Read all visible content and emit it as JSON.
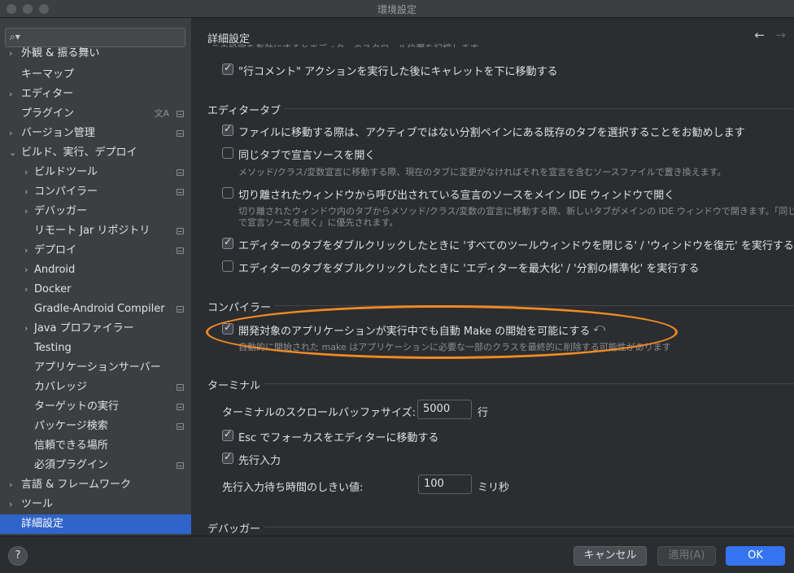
{
  "window": {
    "title": "環境設定"
  },
  "sidebar": {
    "search_placeholder": "",
    "items": [
      {
        "label": "外観 & 振る舞い"
      },
      {
        "label": "キーマップ"
      },
      {
        "label": "エディター"
      },
      {
        "label": "プラグイン"
      },
      {
        "label": "バージョン管理"
      },
      {
        "label": "ビルド、実行、デプロイ"
      },
      {
        "label": "ビルドツール"
      },
      {
        "label": "コンパイラー"
      },
      {
        "label": "デバッガー"
      },
      {
        "label": "リモート Jar リポジトリ"
      },
      {
        "label": "デプロイ"
      },
      {
        "label": "Android"
      },
      {
        "label": "Docker"
      },
      {
        "label": "Gradle-Android Compiler"
      },
      {
        "label": "Java プロファイラー"
      },
      {
        "label": "Testing"
      },
      {
        "label": "アプリケーションサーバー"
      },
      {
        "label": "カバレッジ"
      },
      {
        "label": "ターゲットの実行"
      },
      {
        "label": "パッケージ検索"
      },
      {
        "label": "信頼できる場所"
      },
      {
        "label": "必須プラグイン"
      },
      {
        "label": "言語 & フレームワーク"
      },
      {
        "label": "ツール"
      },
      {
        "label": "詳細設定"
      }
    ]
  },
  "content": {
    "title": "詳細設定",
    "top_partial_text": "この設定を有効にするとエディターのスクロール位置を記憶します",
    "line_comment": "\"行コメント\" アクションを実行した後にキャレットを下に移動する",
    "editor_tabs": {
      "header": "エディタータブ",
      "opt1": "ファイルに移動する際は、アクティブではない分割ペインにある既存のタブを選択することをお勧めします",
      "opt2": "同じタブで宣言ソースを開く",
      "opt2_note": "メソッド/クラス/変数宣言に移動する際、現在のタブに変更がなければそれを宣言を含むソースファイルで置き換えます。",
      "opt3": "切り離されたウィンドウから呼び出されている宣言のソースをメイン IDE ウィンドウで開く",
      "opt3_note1": "切り離されたウィンドウ内のタブからメソッド/クラス/変数の宣言に移動する際、新しいタブがメインの IDE ウィンドウで開きます。「同じ",
      "opt3_note2": "で宣言ソースを開く」に優先されます。",
      "opt4": "エディターのタブをダブルクリックしたときに 'すべてのツールウィンドウを閉じる' / 'ウィンドウを復元' を実行する",
      "opt5": "エディターのタブをダブルクリックしたときに 'エディターを最大化' / '分割の標準化' を実行する"
    },
    "compiler": {
      "header": "コンパイラー",
      "opt1": "開発対象のアプリケーションが実行中でも自動 Make の開始を可能にする",
      "opt1_note": "自動的に開始された make はアプリケーションに必要な一部のクラスを最終的に削除する可能性があります"
    },
    "terminal": {
      "header": "ターミナル",
      "buffer_label": "ターミナルのスクロールバッファサイズ:",
      "buffer_value": "5000",
      "buffer_unit": "行",
      "esc_opt": "Esc でフォーカスをエディターに移動する",
      "typeahead_opt": "先行入力",
      "timeout_label": "先行入力待ち時間のしきい値:",
      "timeout_value": "100",
      "timeout_unit": "ミリ秒"
    },
    "debugger": {
      "header": "デバッガー"
    }
  },
  "footer": {
    "help": "?",
    "cancel": "キャンセル",
    "apply": "適用(A)",
    "ok": "OK"
  },
  "colors": {
    "accent": "#3574f0",
    "selection": "#2f65ca",
    "highlight": "#f08a24"
  }
}
